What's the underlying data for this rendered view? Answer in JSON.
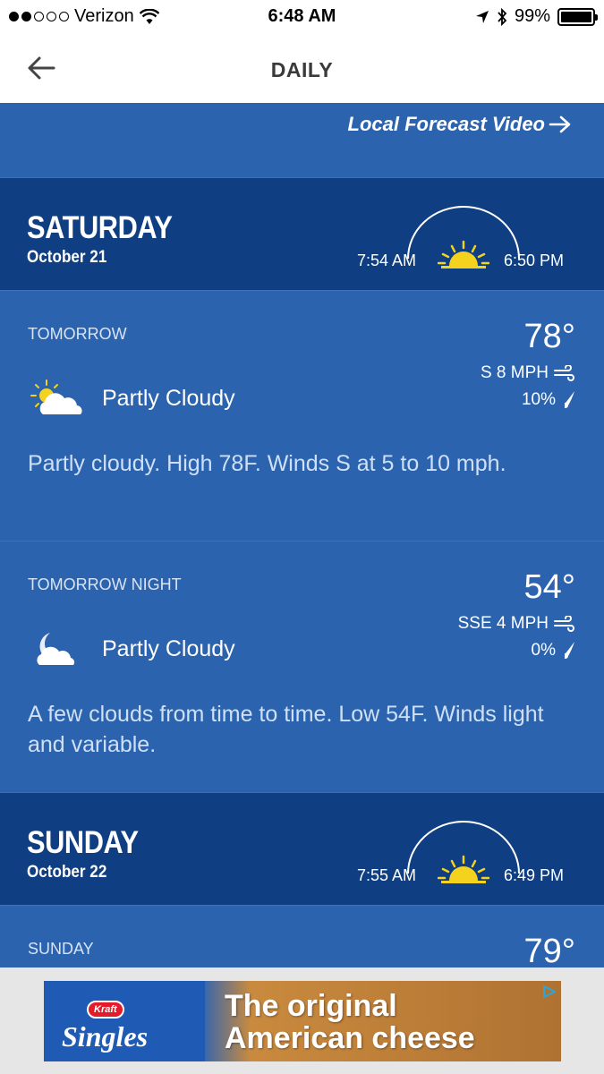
{
  "status_bar": {
    "carrier": "Verizon",
    "time": "6:48 AM",
    "battery": "99%"
  },
  "nav": {
    "title": "DAILY"
  },
  "video_link": "Local Forecast Video",
  "days": [
    {
      "name": "SATURDAY",
      "date": "October 21",
      "sunrise": "7:54 AM",
      "sunset": "6:50 PM",
      "periods": [
        {
          "label": "TOMORROW",
          "temp": "78°",
          "wind": "S 8 MPH",
          "precip": "10%",
          "icon": "partly-cloudy-day-icon",
          "condition": "Partly Cloudy",
          "description": "Partly cloudy. High 78F. Winds S at 5 to 10 mph."
        },
        {
          "label": "TOMORROW NIGHT",
          "temp": "54°",
          "wind": "SSE 4 MPH",
          "precip": "0%",
          "icon": "partly-cloudy-night-icon",
          "condition": "Partly Cloudy",
          "description": "A few clouds from time to time. Low 54F. Winds light and variable."
        }
      ]
    },
    {
      "name": "SUNDAY",
      "date": "October 22",
      "sunrise": "7:55 AM",
      "sunset": "6:49 PM",
      "periods": [
        {
          "label": "SUNDAY",
          "temp": "79°"
        }
      ]
    }
  ],
  "ad": {
    "brand_badge": "Kraft",
    "brand_name": "Singles",
    "headline_line1": "The original",
    "headline_line2": "American cheese"
  },
  "colors": {
    "header_blue": "#0f3f82",
    "panel_blue": "#2b63ae",
    "sun_yellow": "#f5d21e"
  }
}
